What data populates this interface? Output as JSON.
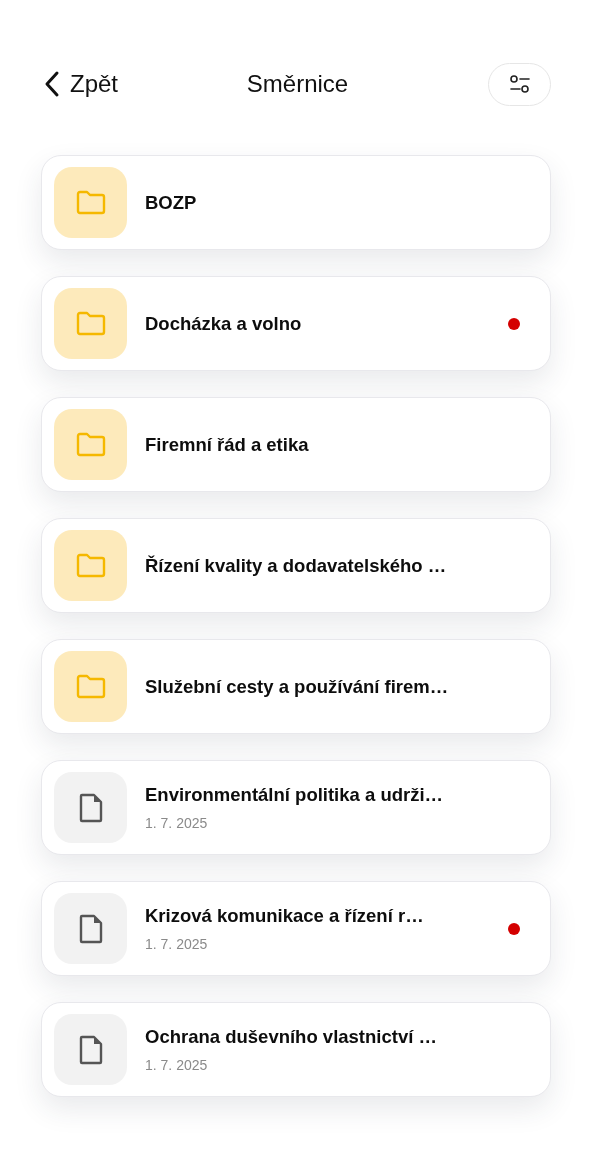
{
  "header": {
    "back_label": "Zpět",
    "title": "Směrnice"
  },
  "items": [
    {
      "kind": "folder",
      "title": "BOZP",
      "unread": false
    },
    {
      "kind": "folder",
      "title": "Docházka a volno",
      "unread": true
    },
    {
      "kind": "folder",
      "title": "Firemní řád a etika",
      "unread": false
    },
    {
      "kind": "folder",
      "title": "Řízení kvality a dodavatelského …",
      "unread": false
    },
    {
      "kind": "folder",
      "title": "Služební cesty a používání firem…",
      "unread": false
    },
    {
      "kind": "document",
      "title": "Environmentální politika a udrži…",
      "date": "1. 7. 2025",
      "unread": false
    },
    {
      "kind": "document",
      "title": "Krizová komunikace a řízení r…",
      "date": "1. 7. 2025",
      "unread": true
    },
    {
      "kind": "document",
      "title": "Ochrana duševního vlastnictví …",
      "date": "1. 7. 2025",
      "unread": false
    }
  ]
}
